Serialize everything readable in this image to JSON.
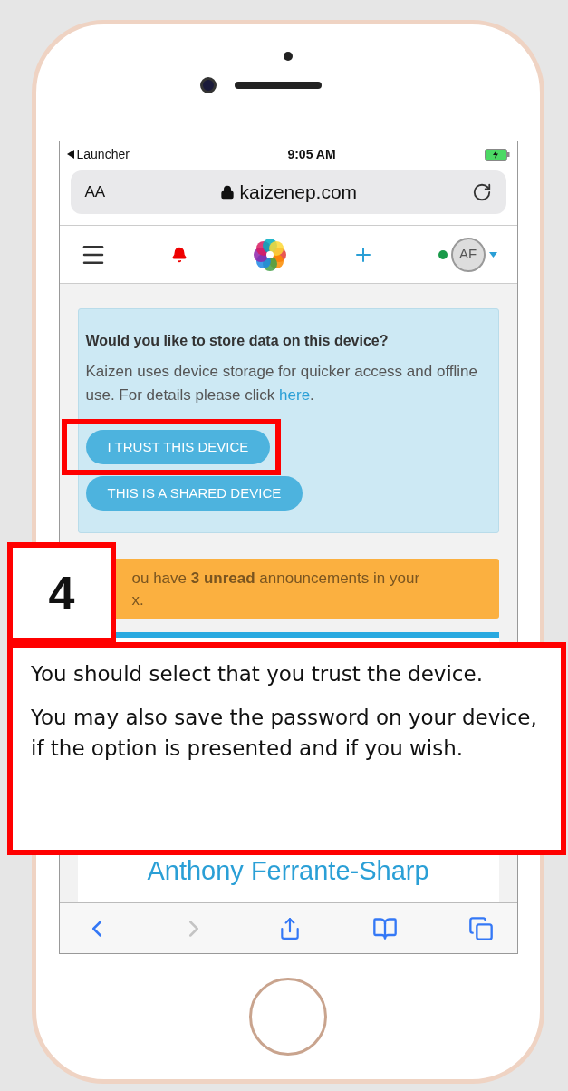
{
  "status_bar": {
    "back_label": "Launcher",
    "time": "9:05 AM"
  },
  "address_bar": {
    "text_size": "AA",
    "url": "kaizenep.com"
  },
  "nav": {
    "avatar_initials": "AF",
    "online": true
  },
  "storage_prompt": {
    "title": "Would you like to store data on this device?",
    "body": "Kaizen uses device storage for quicker access and offline use. For details please click",
    "link": "here",
    "body_end": ".",
    "buttons": [
      {
        "label": "I TRUST THIS DEVICE",
        "highlighted": true
      },
      {
        "label": "THIS IS A SHARED DEVICE",
        "highlighted": false
      }
    ]
  },
  "announcement": {
    "text": "ou have **3 unread** announcements in your",
    "text_2": "x."
  },
  "profile": {
    "name": "Anthony Ferrante-Sharp"
  },
  "toolbar": {
    "back_enabled": true,
    "forward_enabled": false
  },
  "callout": {
    "step": "4",
    "paragraphs": [
      "You should select that you trust the device.",
      "You may also save the password on your device, if the option is presented and if you wish."
    ]
  }
}
